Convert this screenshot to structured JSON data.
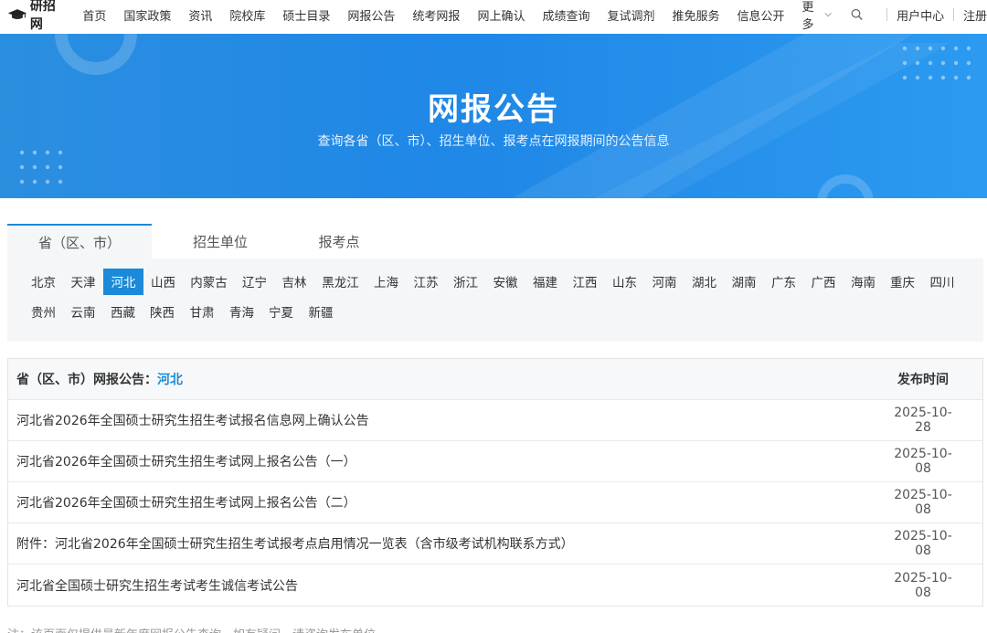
{
  "nav": {
    "logo": "研招网",
    "items": [
      "首页",
      "国家政策",
      "资讯",
      "院校库",
      "硕士目录",
      "网报公告",
      "统考网报",
      "网上确认",
      "成绩查询",
      "复试调剂",
      "推免服务",
      "信息公开"
    ],
    "more": "更多",
    "user_center": "用户中心",
    "register": "注册"
  },
  "banner": {
    "title": "网报公告",
    "subtitle": "查询各省（区、市）、招生单位、报考点在网报期间的公告信息"
  },
  "tabs": [
    "省（区、市）",
    "招生单位",
    "报考点"
  ],
  "provinces": {
    "row1": [
      "北京",
      "天津",
      "河北",
      "山西",
      "内蒙古",
      "辽宁",
      "吉林",
      "黑龙江",
      "上海",
      "江苏",
      "浙江",
      "安徽",
      "福建",
      "江西",
      "山东",
      "河南",
      "湖北",
      "湖南",
      "广东",
      "广西",
      "海南",
      "重庆",
      "四川"
    ],
    "row2": [
      "贵州",
      "云南",
      "西藏",
      "陕西",
      "甘肃",
      "青海",
      "宁夏",
      "新疆"
    ],
    "selected": "河北"
  },
  "table": {
    "head_label": "省（区、市）网报公告：",
    "head_value": "河北",
    "date_header": "发布时间",
    "rows": [
      {
        "title": "河北省2026年全国硕士研究生招生考试报名信息网上确认公告",
        "date": "2025-10-28"
      },
      {
        "title": "河北省2026年全国硕士研究生招生考试网上报名公告（一）",
        "date": "2025-10-08"
      },
      {
        "title": "河北省2026年全国硕士研究生招生考试网上报名公告（二）",
        "date": "2025-10-08"
      },
      {
        "title": "附件：河北省2026年全国硕士研究生招生考试报考点启用情况一览表（含市级考试机构联系方式）",
        "date": "2025-10-08"
      },
      {
        "title": "河北省全国硕士研究生招生考试考生诚信考试公告",
        "date": "2025-10-08"
      }
    ]
  },
  "note": "注：该页面仅提供最新年度网报公告查询，如有疑问，请咨询发布单位。"
}
